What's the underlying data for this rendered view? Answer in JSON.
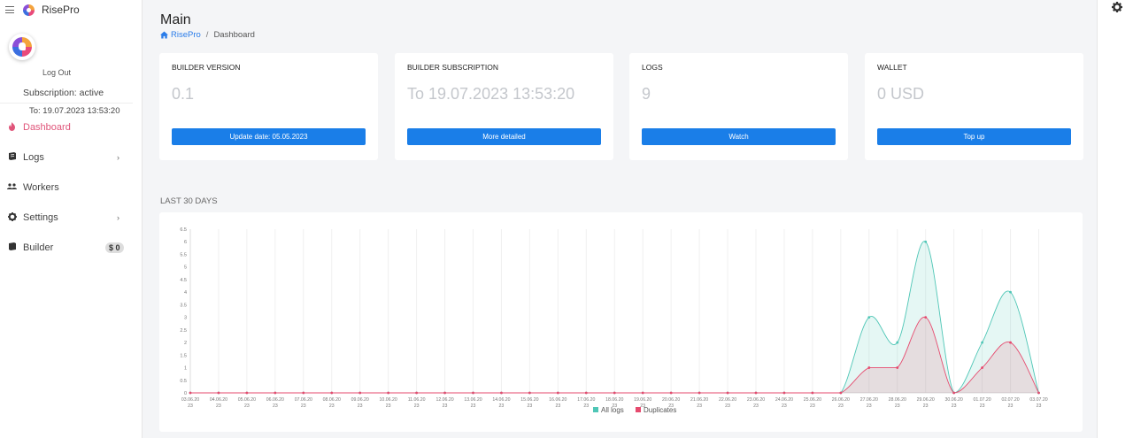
{
  "app": {
    "brand": "RisePro"
  },
  "profile": {
    "logout_label": "Log Out",
    "subscription_status": "Subscription: active",
    "subscription_to": "To: 19.07.2023 13:53:20"
  },
  "sidebar": {
    "items": [
      {
        "label": "Dashboard",
        "icon": "fire-icon",
        "active": true
      },
      {
        "label": "Logs",
        "icon": "logs-icon",
        "chevron": true
      },
      {
        "label": "Workers",
        "icon": "workers-icon"
      },
      {
        "label": "Settings",
        "icon": "gear-icon",
        "chevron": true
      },
      {
        "label": "Builder",
        "icon": "builder-icon",
        "badge": "$ 0"
      }
    ]
  },
  "header": {
    "title": "Main",
    "breadcrumb_home": "RisePro",
    "breadcrumb_separator": "/",
    "breadcrumb_current": "Dashboard"
  },
  "cards": [
    {
      "title": "BUILDER VERSION",
      "value": "0.1",
      "button": "Update date: 05.05.2023"
    },
    {
      "title": "BUILDER SUBSCRIPTION",
      "value": "To 19.07.2023 13:53:20",
      "button": "More detailed"
    },
    {
      "title": "LOGS",
      "value": "9",
      "button": "Watch"
    },
    {
      "title": "WALLET",
      "value": "0 USD",
      "button": "Top up"
    }
  ],
  "chart_section": {
    "title": "LAST 30 DAYS"
  },
  "chart_data": {
    "type": "area",
    "ylim": [
      0,
      6.5
    ],
    "yticks": [
      "0",
      "0.5",
      "1",
      "1.5",
      "2",
      "2.5",
      "3",
      "3.5",
      "4",
      "4.5",
      "5",
      "5.5",
      "6",
      "6.5"
    ],
    "categories": [
      "03.06.20 23",
      "04.06.20 23",
      "05.06.20 23",
      "06.06.20 23",
      "07.06.20 23",
      "08.06.20 23",
      "09.06.20 23",
      "10.06.20 23",
      "11.06.20 23",
      "12.06.20 23",
      "13.06.20 23",
      "14.06.20 23",
      "15.06.20 23",
      "16.06.20 23",
      "17.06.20 23",
      "18.06.20 23",
      "19.06.20 23",
      "20.06.20 23",
      "21.06.20 23",
      "22.06.20 23",
      "23.06.20 23",
      "24.06.20 23",
      "25.06.20 23",
      "26.06.20 23",
      "27.06.20 23",
      "28.06.20 23",
      "29.06.20 23",
      "30.06.20 23",
      "01.07.20 23",
      "02.07.20 23",
      "03.07.20 23"
    ],
    "series": [
      {
        "name": "All logs",
        "color": "#4fc6b6",
        "values": [
          0,
          0,
          0,
          0,
          0,
          0,
          0,
          0,
          0,
          0,
          0,
          0,
          0,
          0,
          0,
          0,
          0,
          0,
          0,
          0,
          0,
          0,
          0,
          0,
          3,
          2,
          6,
          0,
          2,
          4,
          0
        ]
      },
      {
        "name": "Duplicates",
        "color": "#e64a6e",
        "values": [
          0,
          0,
          0,
          0,
          0,
          0,
          0,
          0,
          0,
          0,
          0,
          0,
          0,
          0,
          0,
          0,
          0,
          0,
          0,
          0,
          0,
          0,
          0,
          0,
          1,
          1,
          3,
          0,
          1,
          2,
          0
        ]
      }
    ],
    "legend": "bottom"
  }
}
